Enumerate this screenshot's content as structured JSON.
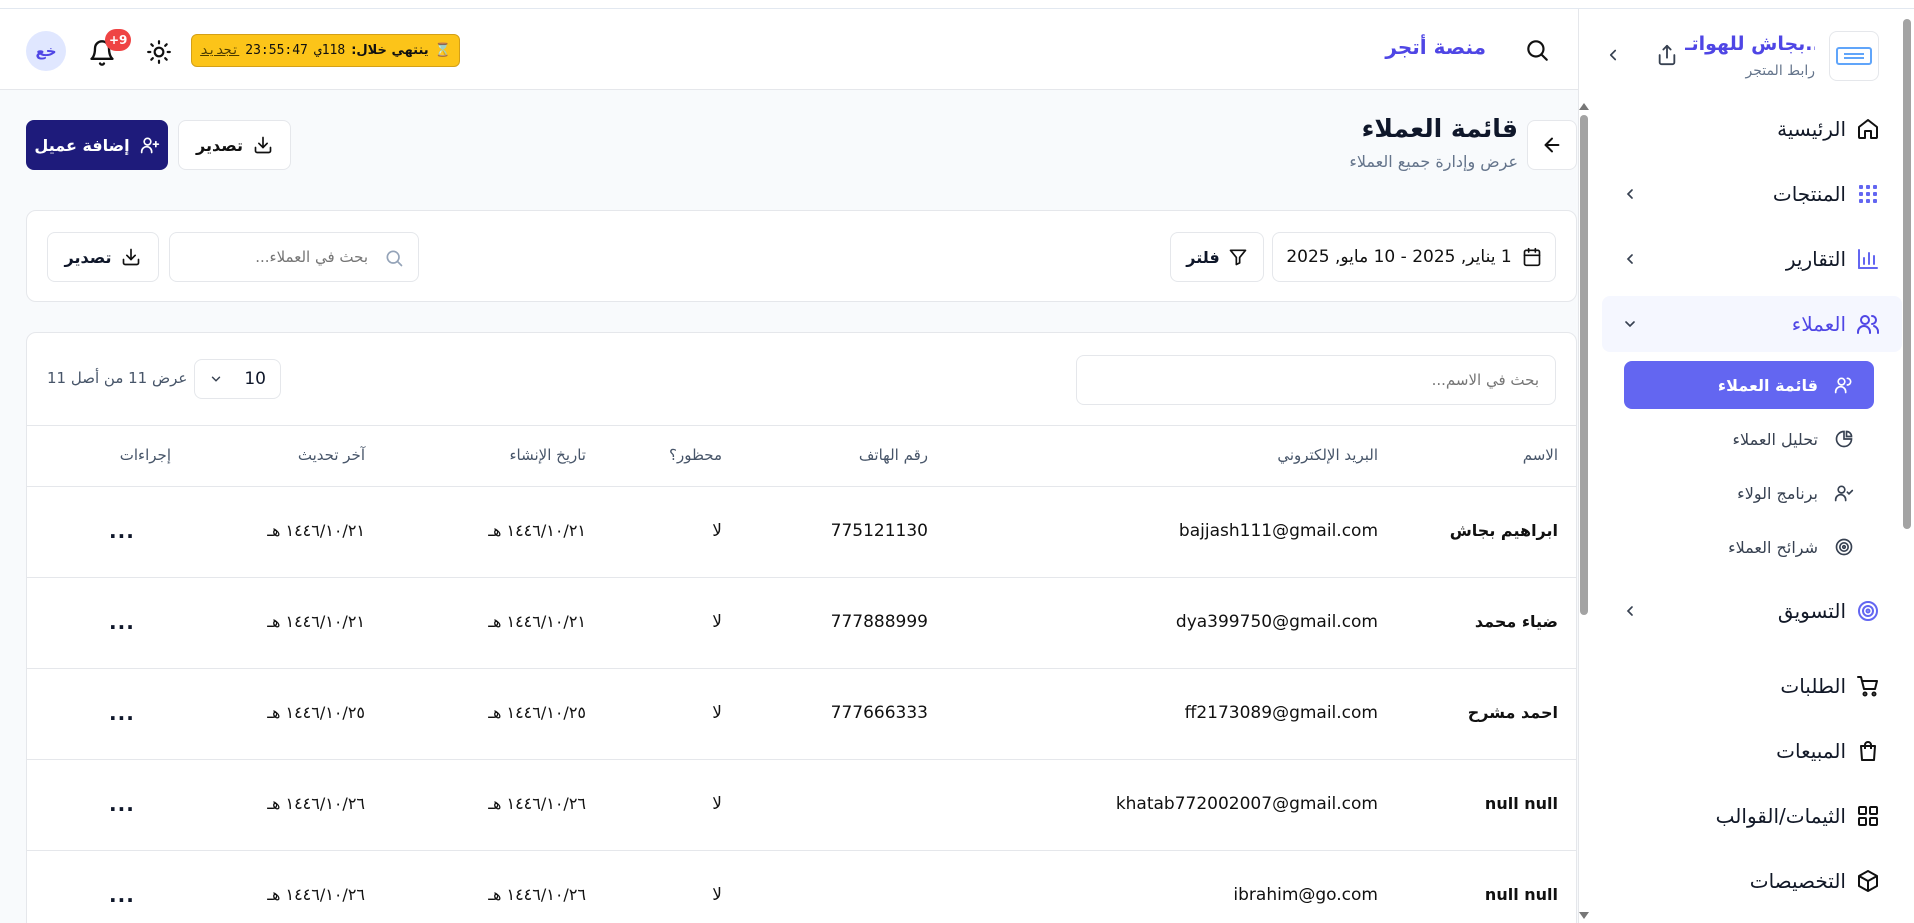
{
  "sidebar": {
    "store_name": "بجاش للهواتـ...",
    "store_link_label": "رابط المتجر",
    "items": [
      {
        "label": "الرئيسية",
        "icon": "home-icon"
      },
      {
        "label": "المنتجات",
        "icon": "products-icon"
      },
      {
        "label": "التقارير",
        "icon": "bar-chart-icon"
      },
      {
        "label": "العملاء",
        "icon": "users-icon"
      },
      {
        "label": "التسويق",
        "icon": "target-icon"
      },
      {
        "label": "الطلبات",
        "icon": "cart-icon"
      },
      {
        "label": "المبيعات",
        "icon": "shopping-bag-icon"
      },
      {
        "label": "الثيمات/القوالب",
        "icon": "grid-icon"
      },
      {
        "label": "التخصيصات",
        "icon": "box-icon"
      }
    ],
    "sub_items": [
      {
        "label": "قائمة العملاء",
        "icon": "user-icon"
      },
      {
        "label": "تحليل العملاء",
        "icon": "pie-chart-icon"
      },
      {
        "label": "برنامج الولاء",
        "icon": "user-check-icon"
      },
      {
        "label": "شرائح العملاء",
        "icon": "target-icon"
      }
    ]
  },
  "header": {
    "brand": "منصة أتجر",
    "subscription": {
      "label": "ينتهي خلال:",
      "days": "118ي",
      "time": "23:55:47",
      "renew": "تجديد"
    },
    "notifications_badge": "+9",
    "avatar_initials": "خع"
  },
  "page": {
    "title": "قائمة العملاء",
    "subtitle": "عرض وإدارة جميع العملاء",
    "add_button": "إضافة عميل",
    "export_button": "تصدير"
  },
  "filters": {
    "date_range": "1 يناير, 2025 - 10 مايو, 2025",
    "filter_button": "فلتر",
    "search_placeholder": "بحث في العملاء...",
    "export_button": "تصدير"
  },
  "table": {
    "name_search_placeholder": "بحث في الاسم...",
    "page_size": "10",
    "count_text": "عرض 11 من أصل 11",
    "columns": [
      "الاسم",
      "البريد الإلكتروني",
      "رقم الهاتف",
      "محظور؟",
      "تاريخ الإنشاء",
      "آخر تحديث",
      "إجراءات"
    ],
    "rows": [
      {
        "name": "ابراهيم بجاش",
        "email": "bajjash111@gmail.com",
        "phone": "775121130",
        "banned": "لا",
        "created": "١٤٤٦/١٠/٢١ هـ",
        "updated": "١٤٤٦/١٠/٢١ هـ",
        "actions": "..."
      },
      {
        "name": "ضياء محمد",
        "email": "dya399750@gmail.com",
        "phone": "777888999",
        "banned": "لا",
        "created": "١٤٤٦/١٠/٢١ هـ",
        "updated": "١٤٤٦/١٠/٢١ هـ",
        "actions": "..."
      },
      {
        "name": "احمد مشرح",
        "email": "ff2173089@gmail.com",
        "phone": "777666333",
        "banned": "لا",
        "created": "١٤٤٦/١٠/٢٥ هـ",
        "updated": "١٤٤٦/١٠/٢٥ هـ",
        "actions": "..."
      },
      {
        "name": "null null",
        "email": "khatab772002007@gmail.com",
        "phone": "",
        "banned": "لا",
        "created": "١٤٤٦/١٠/٢٦ هـ",
        "updated": "١٤٤٦/١٠/٢٦ هـ",
        "actions": "..."
      },
      {
        "name": "null null",
        "email": "ibrahim@go.com",
        "phone": "",
        "banned": "لا",
        "created": "١٤٤٦/١٠/٢٦ هـ",
        "updated": "١٤٤٦/١٠/٢٦ هـ",
        "actions": "..."
      }
    ]
  },
  "colors": {
    "accent": "#4f46e5",
    "primary_button": "#1e1b7b",
    "warning_badge": "#fcc419",
    "danger": "#ef4444"
  }
}
